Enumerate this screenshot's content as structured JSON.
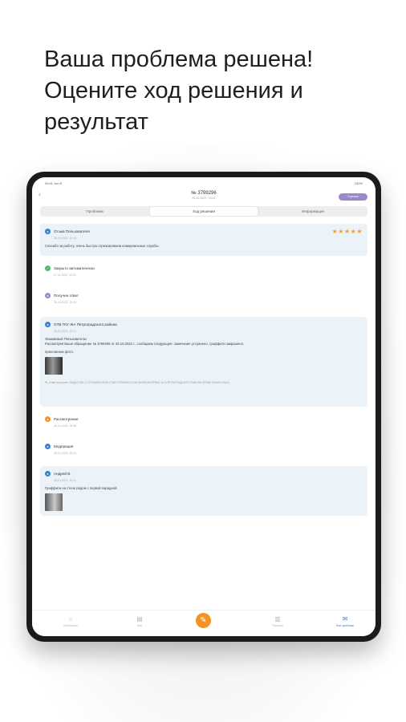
{
  "headline": {
    "line1": "Ваша проблема решена!",
    "line2": "Оцените ход решения и",
    "line3": "результат"
  },
  "device": {
    "status_time": "09:41 Jun 8",
    "status_right": "100%",
    "nav": {
      "back_icon": "chevron-left-icon",
      "title": "№ 3799296",
      "subtitle": "26.10.2022 · 10:11",
      "action_label": "Оценить"
    },
    "segments": [
      "Проблема",
      "Ход решения",
      "Информация"
    ],
    "active_segment": 1,
    "timeline": [
      {
        "title": "Отзыв Пользователя",
        "date": "26.10.2022, 19:13",
        "text": "Спасибо за работу, очень быстро отреагировали коммунальные службы",
        "color": "#3b7fd1",
        "stars": "★★★★★",
        "rating": 5
      },
      {
        "title": "Закрыто автоматически",
        "date": "07.11.2022, 12:21",
        "color": "#4cb86a"
      },
      {
        "title": "Получен ответ",
        "date": "26.10.2022, 20:04",
        "color": "#9a89c6"
      },
      {
        "title": "ОТВ ГКУ ЖА Петроградского района",
        "date": "26.10.2022, 19:21",
        "text": "Уважаемый Пользователь!",
        "text2": "Рассмотрев Ваше обращение № 3799296 от 26.10.2022 г., сообщаем следующее: замечание устранено, граффити закрашено.",
        "text3": "приложение фото.",
        "footer": "Ответ выполнен ОБЩЕСТВО С ОГРАНИЧЕННОЙ ОТВЕТСТВЕННОСТЬЮ ЖИЛКОМСЕРВИС № 2 ПЕТРОГРАДСКОГО РАЙОНА ЭРИКА ТИХАЯ ОЛЬГА",
        "color": "#3b7fd1"
      },
      {
        "title": "Рассмотрение",
        "date": "26.10.2022, 09:35",
        "color": "#f39324"
      },
      {
        "title": "Модерация",
        "date": "26.10.2022, 10:21",
        "color": "#3b7fd1"
      },
      {
        "title": "Андрей В.",
        "date": "26.10.2022, 10:11",
        "text": "Граффити на стене рядом с первой парадной.",
        "color": "#3b7fd1"
      }
    ],
    "tabbar": [
      {
        "label": "Мой портал",
        "icon": "home-icon"
      },
      {
        "label": "Мой",
        "icon": "document-icon"
      },
      {
        "label": "",
        "icon": "add-problem-icon"
      },
      {
        "label": "Рейтинги",
        "icon": "chart-icon"
      },
      {
        "label": "Мои проблемы",
        "icon": "mail-icon"
      }
    ]
  }
}
